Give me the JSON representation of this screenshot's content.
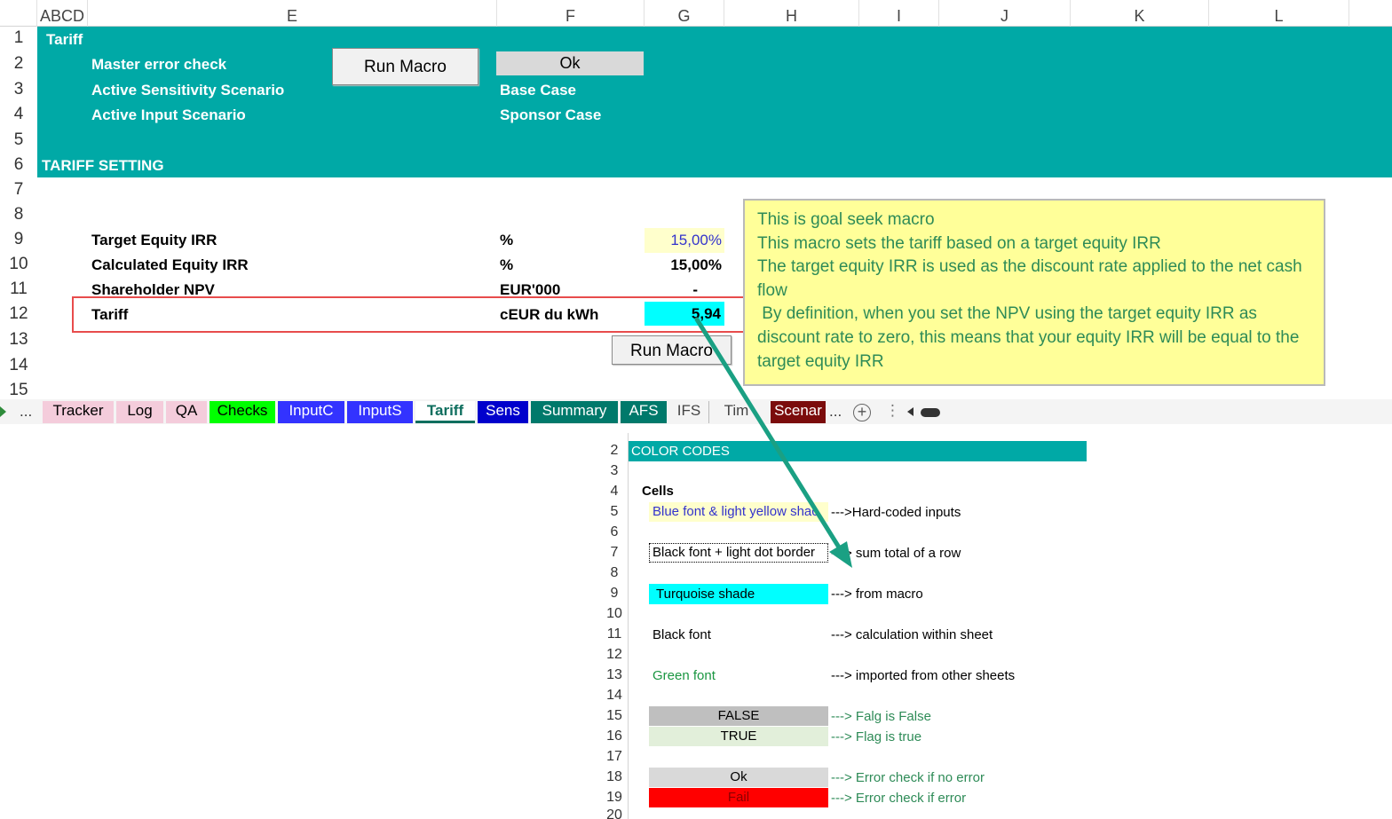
{
  "columns": [
    "ABCD",
    "E",
    "F",
    "G",
    "H",
    "I",
    "J",
    "K",
    "L"
  ],
  "rows": [
    "1",
    "2",
    "3",
    "4",
    "5",
    "6",
    "7",
    "8",
    "9",
    "10",
    "11",
    "12",
    "13",
    "14",
    "15"
  ],
  "header_section": {
    "title": "Tariff",
    "master_error_check_label": "Master error check",
    "sensitivity_label": "Active Sensitivity Scenario",
    "input_scenario_label": "Active Input Scenario",
    "run_macro_label": "Run Macro",
    "status_value": "Ok",
    "sensitivity_value": "Base Case",
    "input_scenario_value": "Sponsor Case"
  },
  "tariff_setting": {
    "title": "TARIFF SETTING",
    "rows": [
      {
        "label": "Target Equity IRR",
        "unit": "%",
        "value": "15,00%"
      },
      {
        "label": "Calculated Equity IRR",
        "unit": "%",
        "value": "15,00%"
      },
      {
        "label": "Shareholder NPV",
        "unit": "EUR'000",
        "value": "-"
      },
      {
        "label": "Tariff",
        "unit": "cEUR du kWh",
        "value": "5,94"
      }
    ],
    "run_macro_label": "Run Macro"
  },
  "note": {
    "lines": [
      "This is goal seek macro",
      "This macro sets the tariff based on a target equity IRR",
      "The target equity IRR is used as the discount rate applied to the net cash flow",
      " By definition, when you set the NPV using the target equity IRR as discount rate to zero, this means that your equity IRR will be equal to the target equity IRR"
    ]
  },
  "sheet_tabs": {
    "more_left": "...",
    "more_right": "...",
    "tabs": [
      {
        "label": "Tracker",
        "bg": "#f4ccdb",
        "fg": "#000000"
      },
      {
        "label": "Log",
        "bg": "#f4ccdb",
        "fg": "#000000"
      },
      {
        "label": "QA",
        "bg": "#f4ccdb",
        "fg": "#000000"
      },
      {
        "label": "Checks",
        "bg": "#00ff00",
        "fg": "#000000"
      },
      {
        "label": "InputC",
        "bg": "#3333ff",
        "fg": "#ffffff"
      },
      {
        "label": "InputS",
        "bg": "#3333ff",
        "fg": "#ffffff"
      },
      {
        "label": "Tariff",
        "bg": "#ffffff",
        "fg": "#0e6e5e"
      },
      {
        "label": "Sens",
        "bg": "#0000cc",
        "fg": "#ffffff"
      },
      {
        "label": "Summary",
        "bg": "#00796b",
        "fg": "#ffffff"
      },
      {
        "label": "AFS",
        "bg": "#00796b",
        "fg": "#ffffff"
      },
      {
        "label": "IFS",
        "bg": "#f4f4f4",
        "fg": "#444444"
      },
      {
        "label": "Tim",
        "bg": "#f4f4f4",
        "fg": "#444444"
      },
      {
        "label": "Scenar",
        "bg": "#7b0c0c",
        "fg": "#ffffff"
      }
    ]
  },
  "legend": {
    "rows": [
      "2",
      "3",
      "4",
      "5",
      "6",
      "7",
      "8",
      "9",
      "10",
      "11",
      "12",
      "13",
      "14",
      "15",
      "16",
      "17",
      "18",
      "19",
      "20"
    ],
    "title": "COLOR CODES",
    "cells_label": "Cells",
    "items": {
      "hardcoded": {
        "sample": "Blue font & light yellow shac",
        "desc": "--->Hard-coded inputs"
      },
      "sum": {
        "sample": "Black font + light dot border",
        "desc": "---> sum total of a row"
      },
      "macro": {
        "sample": "Turquoise shade",
        "desc": "---> from macro"
      },
      "calc": {
        "sample": "Black font",
        "desc": "---> calculation within sheet"
      },
      "imported": {
        "sample": "Green font",
        "desc": "---> imported from other sheets"
      },
      "false": {
        "sample": "FALSE",
        "desc": "---> Falg is False"
      },
      "true": {
        "sample": "TRUE",
        "desc": "---> Flag is true"
      },
      "ok": {
        "sample": "Ok",
        "desc": "---> Error check if no error"
      },
      "fail": {
        "sample": "Fail",
        "desc": "---> Error check if error"
      }
    }
  },
  "colors": {
    "teal": "#00a9a6",
    "turquoise": "#00ffff",
    "light_yellow": "#ffffcc",
    "input_blue": "#3333cc",
    "note_yellow": "#ffff99",
    "highlight_red": "#e84c4c",
    "arrow_green": "#1aa083"
  }
}
